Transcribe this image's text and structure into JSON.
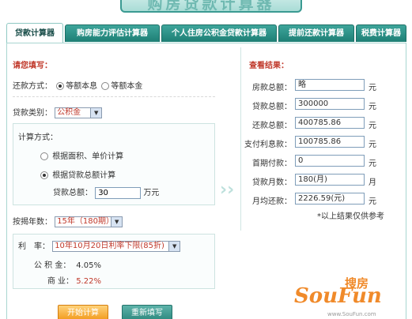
{
  "banner": {
    "title": "购房贷款计算器"
  },
  "tabs": [
    {
      "label": "贷款计算器",
      "active": true
    },
    {
      "label": "购房能力评估计算器",
      "active": false
    },
    {
      "label": "个人住房公积金贷款计算器",
      "active": false
    },
    {
      "label": "提前还款计算器",
      "active": false
    },
    {
      "label": "税费计算器",
      "active": false
    }
  ],
  "form": {
    "heading": "请您填写：",
    "repay_method": {
      "label": "还款方式：",
      "opt1": "等额本息",
      "opt2": "等额本金",
      "selected": "opt1"
    },
    "loan_type": {
      "label": "贷款类别：",
      "value": "公积金"
    },
    "calc_method": {
      "label": "计算方式：",
      "opt1": "根据面积、单价计算",
      "opt2": "根据贷款总额计算",
      "selected": "opt2",
      "total_label": "贷款总额：",
      "total_value": "30",
      "total_unit": "万元"
    },
    "years": {
      "label": "按揭年数：",
      "value": "15年（180期）"
    },
    "rate": {
      "label": "利　率：",
      "value": "10年10月20日利率下限(85折)",
      "fund_label": "公 积 金：",
      "fund_value": "4.05%",
      "biz_label": "商 业：",
      "biz_value": "5.22%"
    }
  },
  "result": {
    "heading": "查看结果：",
    "rows": [
      {
        "label": "房款总额：",
        "value": "略",
        "unit": "元"
      },
      {
        "label": "贷款总额：",
        "value": "300000",
        "unit": "元"
      },
      {
        "label": "还款总额：",
        "value": "400785.86",
        "unit": "元"
      },
      {
        "label": "支付利息款：",
        "value": "100785.86",
        "unit": "元"
      },
      {
        "label": "首期付款：",
        "value": "0",
        "unit": "元"
      },
      {
        "label": "贷款月数：",
        "value": "180(月)",
        "unit": "月"
      },
      {
        "label": "月均还款：",
        "value": "2226.59(元)",
        "unit": "元"
      }
    ],
    "note": "*以上结果仅供参考"
  },
  "buttons": {
    "start": "开始计算",
    "reset": "重新填写"
  },
  "watermark": {
    "brand": "SouFun",
    "cn": "搜房",
    "url": "www.SouFun.com"
  },
  "colors": {
    "accent": "#2a8f85",
    "heading_red": "#c0392b",
    "button_orange": "#f29b1e"
  }
}
